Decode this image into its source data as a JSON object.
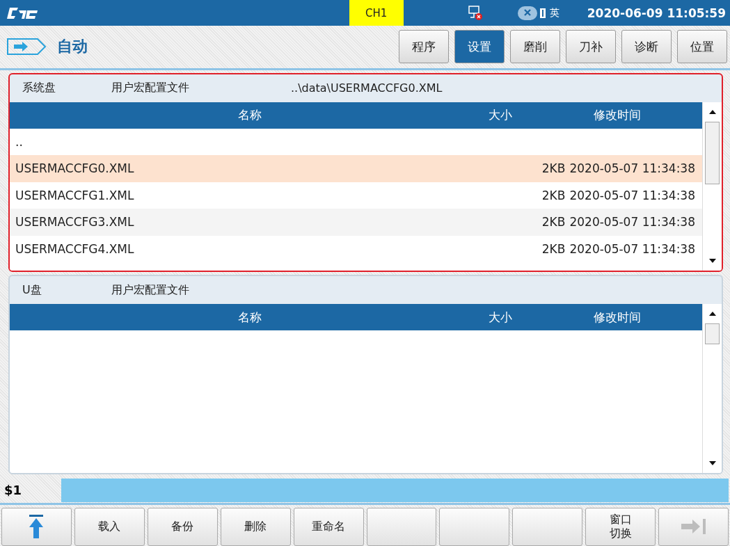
{
  "top_bar": {
    "channel": "CH1",
    "input_method": "英",
    "datetime": "2020-06-09 11:05:59"
  },
  "mode": {
    "label": "自动"
  },
  "tabs": [
    {
      "label": "程序",
      "selected": false
    },
    {
      "label": "设置",
      "selected": true
    },
    {
      "label": "磨削",
      "selected": false
    },
    {
      "label": "刀补",
      "selected": false
    },
    {
      "label": "诊断",
      "selected": false
    },
    {
      "label": "位置",
      "selected": false
    }
  ],
  "panels": [
    {
      "focused": true,
      "drive": "系统盘",
      "type": "用户宏配置文件",
      "path": "..\\data\\USERMACCFG0.XML",
      "columns": [
        "名称",
        "大小",
        "修改时间"
      ],
      "rows": [
        {
          "name": "..",
          "size": "",
          "time": "",
          "selected": false
        },
        {
          "name": "USERMACCFG0.XML",
          "size": "2KB",
          "time": "2020-05-07 11:34:38",
          "selected": true
        },
        {
          "name": "USERMACCFG1.XML",
          "size": "2KB",
          "time": "2020-05-07 11:34:38",
          "selected": false
        },
        {
          "name": "USERMACCFG3.XML",
          "size": "2KB",
          "time": "2020-05-07 11:34:38",
          "selected": false
        },
        {
          "name": "USERMACCFG4.XML",
          "size": "2KB",
          "time": "2020-05-07 11:34:38",
          "selected": false
        }
      ]
    },
    {
      "focused": false,
      "drive": "U盘",
      "type": "用户宏配置文件",
      "columns": [
        "名称",
        "大小",
        "修改时间"
      ]
    }
  ],
  "command_line": {
    "prompt": "$1"
  },
  "softkeys": [
    {
      "kind": "top",
      "disabled": false
    },
    {
      "kind": "text",
      "label": "载入"
    },
    {
      "kind": "text",
      "label": "备份"
    },
    {
      "kind": "text",
      "label": "删除"
    },
    {
      "kind": "text",
      "label": "重命名"
    },
    {
      "kind": "empty"
    },
    {
      "kind": "empty"
    },
    {
      "kind": "empty"
    },
    {
      "kind": "text",
      "label": "窗口切换"
    },
    {
      "kind": "end",
      "disabled": true
    }
  ]
}
